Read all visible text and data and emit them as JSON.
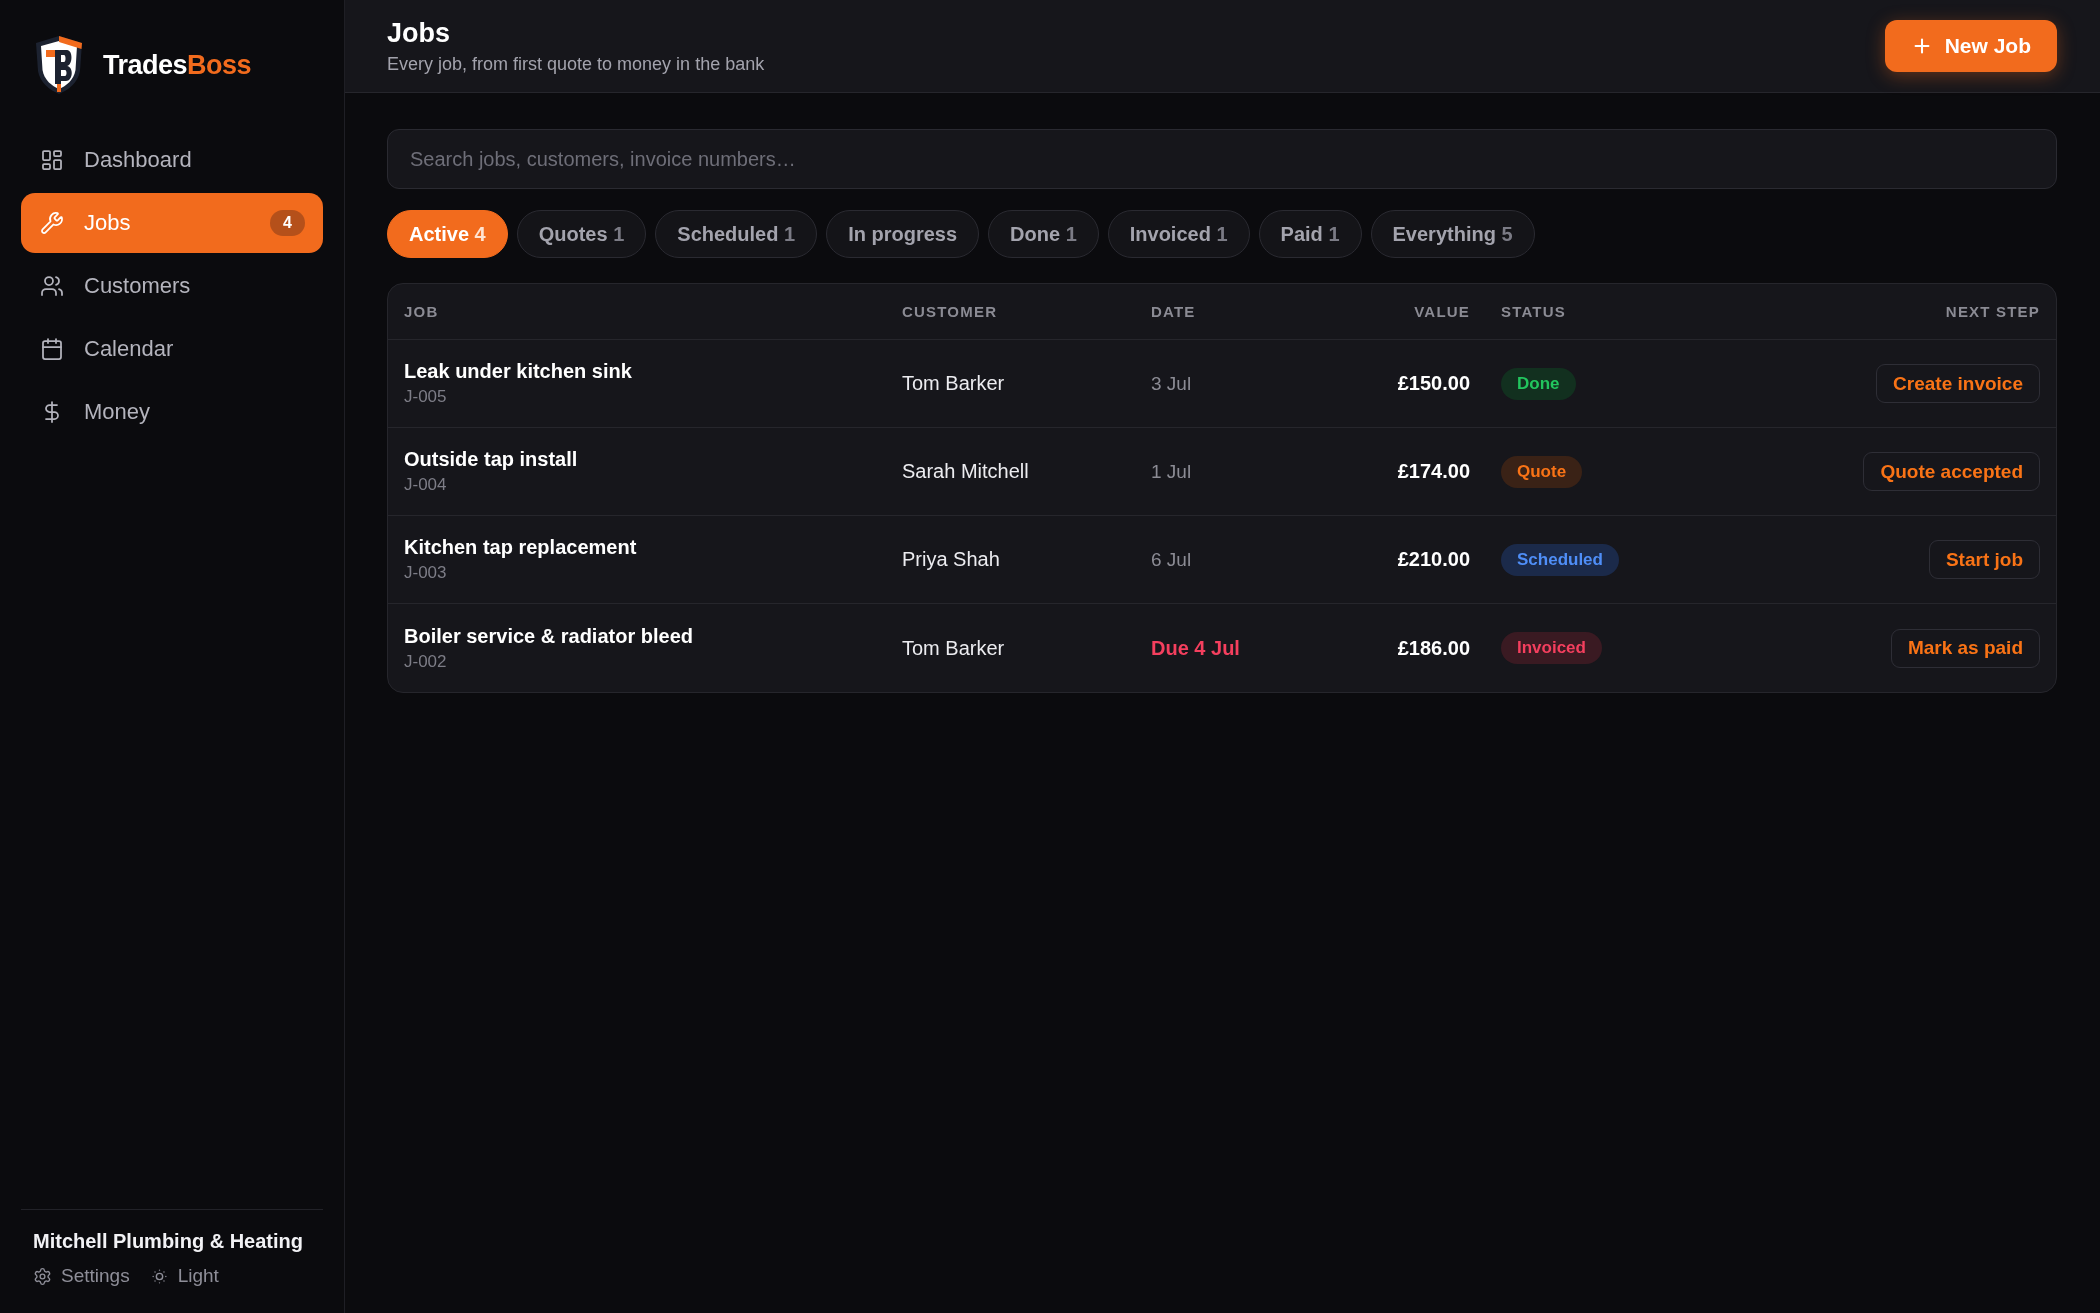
{
  "sidebar": {
    "brand": {
      "name": "Trades",
      "accent": "Boss"
    },
    "nav": [
      {
        "label": "Dashboard",
        "selected": false
      },
      {
        "label": "Jobs",
        "selected": true,
        "badge": "4"
      },
      {
        "label": "Customers",
        "selected": false
      },
      {
        "label": "Calendar",
        "selected": false
      },
      {
        "label": "Money",
        "selected": false
      }
    ],
    "footer": {
      "business": "Mitchell Plumbing & Heating",
      "links": [
        {
          "label": "Settings"
        },
        {
          "label": "Light"
        }
      ]
    }
  },
  "header": {
    "title": "Jobs",
    "subtitle": "Every job, from first quote to money in the bank",
    "new_job_button": "New Job"
  },
  "search": {
    "placeholder": "Search jobs, customers, invoice numbers…"
  },
  "filters": [
    {
      "label": "Active",
      "count": "4",
      "selected": true
    },
    {
      "label": "Quotes",
      "count": "1",
      "selected": false
    },
    {
      "label": "Scheduled",
      "count": "1",
      "selected": false
    },
    {
      "label": "In progress",
      "selected": false
    },
    {
      "label": "Done",
      "count": "1",
      "selected": false
    },
    {
      "label": "Invoiced",
      "count": "1",
      "selected": false
    },
    {
      "label": "Paid",
      "count": "1",
      "selected": false
    },
    {
      "label": "Everything",
      "count": "5",
      "selected": false
    }
  ],
  "table": {
    "columns": [
      "JOB",
      "CUSTOMER",
      "DATE",
      "VALUE",
      "STATUS",
      "NEXT STEP"
    ],
    "rows": [
      {
        "job": "Leak under kitchen sink",
        "id": "J-005",
        "customer": "Tom Barker",
        "date": "3 Jul",
        "overdue": false,
        "value": "£150.00",
        "status": {
          "label": "Done",
          "kind": "done"
        },
        "next_step": "Create invoice"
      },
      {
        "job": "Outside tap install",
        "id": "J-004",
        "customer": "Sarah Mitchell",
        "date": "1 Jul",
        "overdue": false,
        "value": "£174.00",
        "status": {
          "label": "Quote",
          "kind": "quote"
        },
        "next_step": "Quote accepted"
      },
      {
        "job": "Kitchen tap replacement",
        "id": "J-003",
        "customer": "Priya Shah",
        "date": "6 Jul",
        "overdue": false,
        "value": "£210.00",
        "status": {
          "label": "Scheduled",
          "kind": "scheduled"
        },
        "next_step": "Start job"
      },
      {
        "job": "Boiler service & radiator bleed",
        "id": "J-002",
        "customer": "Tom Barker",
        "date": "Due 4 Jul",
        "overdue": true,
        "value": "£186.00",
        "status": {
          "label": "Invoiced",
          "kind": "invoiced"
        },
        "next_step": "Mark as paid"
      }
    ]
  }
}
